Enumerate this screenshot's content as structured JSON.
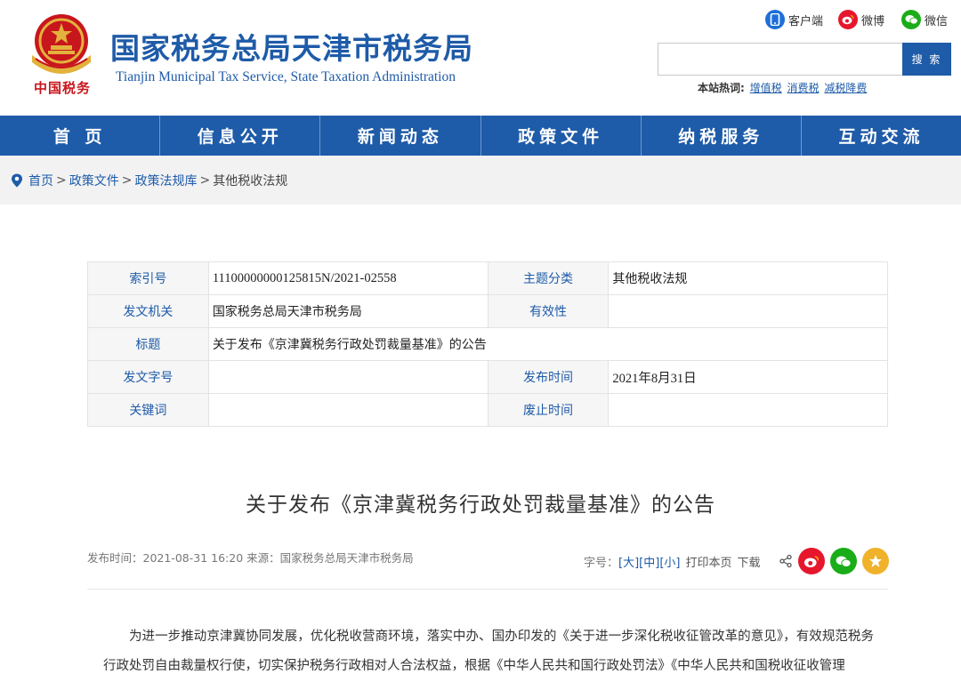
{
  "header": {
    "title": "国家税务总局天津市税务局",
    "subtitle": "Tianjin Municipal Tax Service, State Taxation Administration",
    "brand_script": "中国税务",
    "social": [
      {
        "label": "客户端",
        "icon": "mobile-client-icon",
        "color": "#1e6fd9"
      },
      {
        "label": "微博",
        "icon": "weibo-icon",
        "color": "#e6162d"
      },
      {
        "label": "微信",
        "icon": "wechat-icon",
        "color": "#1aad19"
      }
    ],
    "search": {
      "placeholder": "",
      "button": "搜 索"
    },
    "hot": {
      "label": "本站热词:",
      "terms": [
        "增值税",
        "消费税",
        "减税降费"
      ]
    }
  },
  "nav": [
    "首 页",
    "信息公开",
    "新闻动态",
    "政策文件",
    "纳税服务",
    "互动交流"
  ],
  "breadcrumb": {
    "items": [
      "首页",
      "政策文件",
      "政策法规库"
    ],
    "separator": ">",
    "current": "其他税收法规"
  },
  "info_table": {
    "index_label": "索引号",
    "index_value": "11100000000125815N/2021-02558",
    "topic_label": "主题分类",
    "topic_value": "其他税收法规",
    "issuer_label": "发文机关",
    "issuer_value": "国家税务总局天津市税务局",
    "validity_label": "有效性",
    "validity_value": "",
    "title_label": "标题",
    "title_value": "关于发布《京津冀税务行政处罚裁量基准》的公告",
    "docno_label": "发文字号",
    "docno_value": "",
    "pubdate_label": "发布时间",
    "pubdate_value": "2021年8月31日",
    "keywords_label": "关键词",
    "keywords_value": "",
    "abolish_label": "废止时间",
    "abolish_value": ""
  },
  "article": {
    "title": "关于发布《京津冀税务行政处罚裁量基准》的公告",
    "meta": "发布时间：2021-08-31 16:20 来源：国家税务总局天津市税务局",
    "font_size_label": "字号：",
    "size_large": "[大]",
    "size_medium": "[中]",
    "size_small": "[小]",
    "print": "打印本页",
    "download": "下载",
    "body": "为进一步推动京津冀协同发展，优化税收营商环境，落实中办、国办印发的《关于进一步深化税收征管改革的意见》，有效规范税务行政处罚自由裁量权行使，切实保护税务行政相对人合法权益，根据《中华人民共和国行政处罚法》《中华人民共和国税收征收管理"
  },
  "colors": {
    "brand_blue": "#1e5ba8",
    "emblem_red": "#c8161d",
    "emblem_gold": "#e3b23c"
  }
}
